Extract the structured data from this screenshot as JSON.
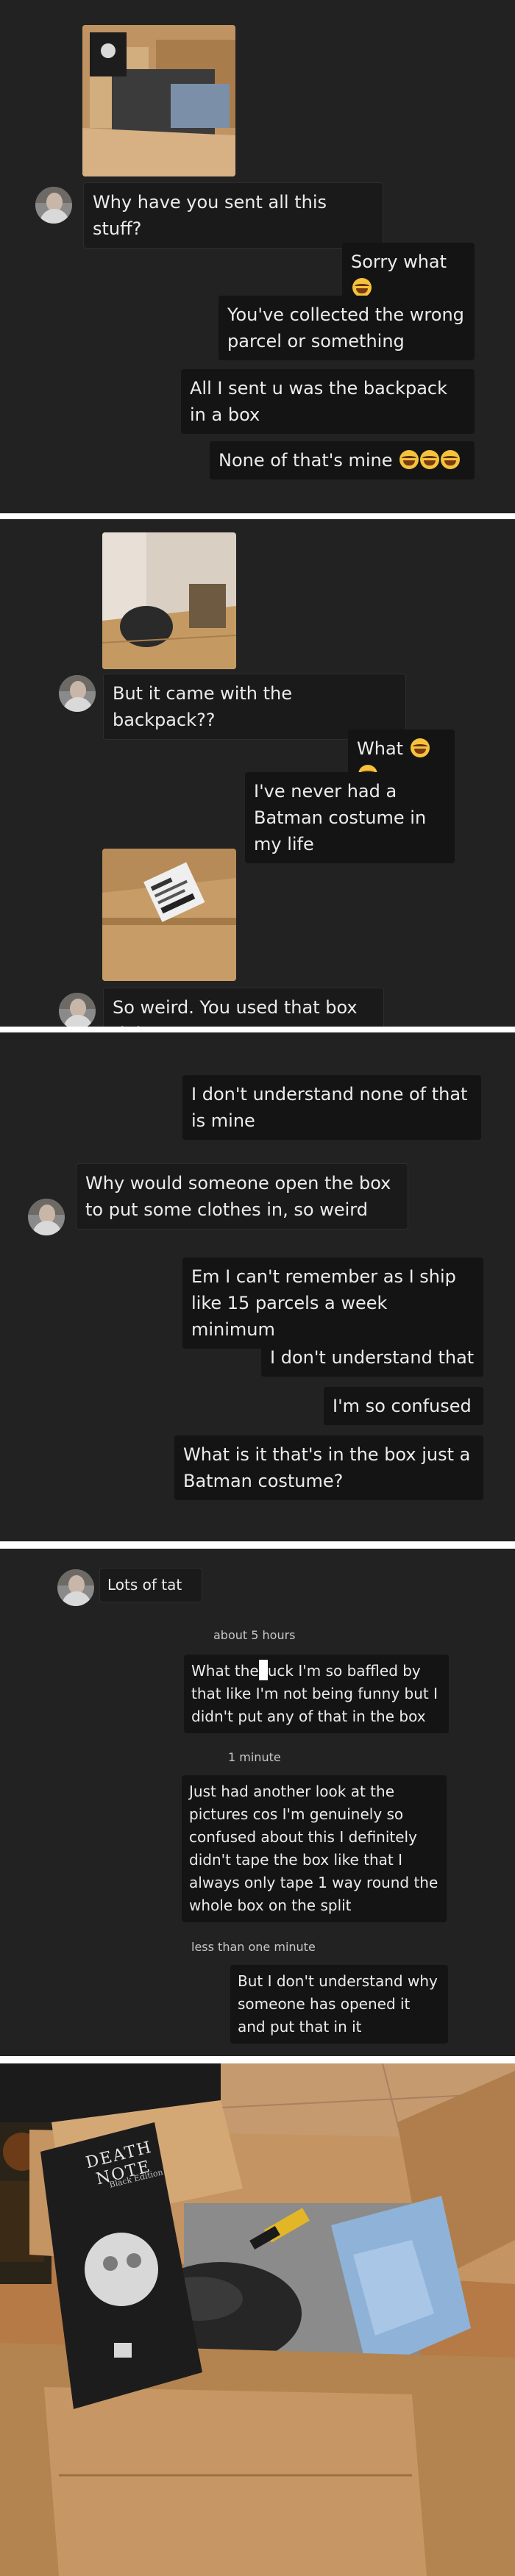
{
  "panel1": {
    "msg_in_1": "Why have you sent all this stuff?",
    "msg_out_1": "Sorry what",
    "msg_out_2": "You've collected the wrong parcel or something",
    "msg_out_3": "All I sent u was the backpack in a box",
    "msg_out_4": "None of that's mine"
  },
  "panel2": {
    "msg_in_1": "But it came with the backpack??",
    "msg_out_1": "What",
    "msg_out_2": "I've never had a Batman costume in my life",
    "msg_in_2": "So weird. You used that box right?"
  },
  "panel3": {
    "msg_out_1": "I don't understand none of that is mine",
    "msg_in_1": "Why would someone open the box to put some clothes in, so weird",
    "msg_out_2": "Em I can't remember as I ship like 15 parcels a week minimum",
    "msg_out_3": "I don't understand that",
    "msg_out_4": "I'm so confused",
    "msg_out_5": "What is it that's in the box just a Batman costume?"
  },
  "panel4": {
    "msg_in_1": "Lots of tat",
    "time_1": "about 5 hours",
    "msg_out_1a": "What the",
    "msg_out_1b": "uck I'm so baffled by that like I'm not being funny but I didn't put any of that in the box",
    "time_2": "1 minute",
    "msg_out_2": "Just had another look at the pictures cos I'm genuinely so confused about this I definitely didn't tape the box like that I always only tape 1 way round the whole box on the split",
    "time_3": "less than one minute",
    "msg_out_3": "But I don't understand why someone has opened it and put that in it"
  },
  "panel5": {
    "book_title": "DEATH NOTE",
    "book_subtitle": "Black Edition"
  }
}
